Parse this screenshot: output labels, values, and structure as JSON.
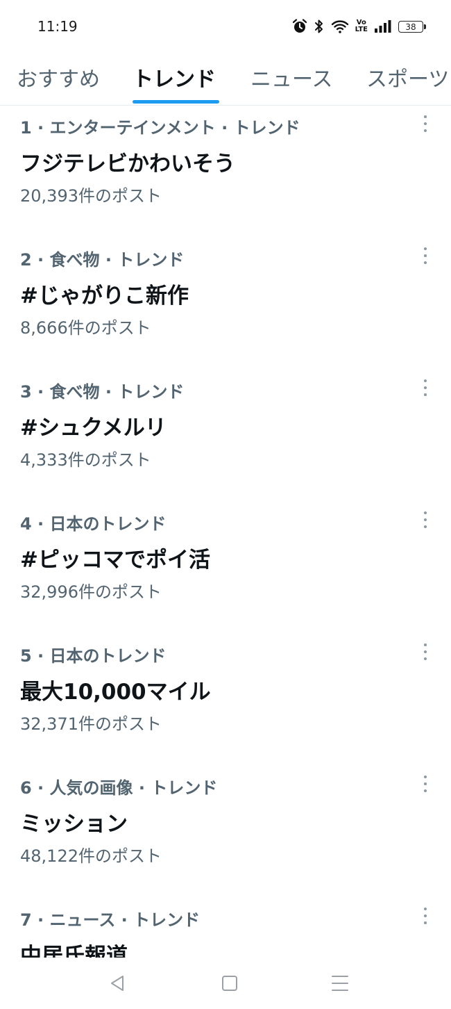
{
  "status_bar": {
    "time": "11:19",
    "icons": [
      "alarm-icon",
      "bluetooth-icon",
      "wifi-icon",
      "volte-icon",
      "signal-icon",
      "battery-icon"
    ],
    "volte_top": "Vo",
    "volte_bottom": "LTE",
    "battery_level": "38"
  },
  "tabs": [
    {
      "label": "おすすめ",
      "active": false
    },
    {
      "label": "トレンド",
      "active": true
    },
    {
      "label": "ニュース",
      "active": false
    },
    {
      "label": "スポーツ",
      "active": false
    }
  ],
  "trends": [
    {
      "context": "1 · エンターテインメント · トレンド",
      "title": "フジテレビかわいそう",
      "count": "20,393件のポスト"
    },
    {
      "context": "2 · 食べ物 · トレンド",
      "title": "#じゃがりこ新作",
      "count": "8,666件のポスト"
    },
    {
      "context": "3 · 食べ物 · トレンド",
      "title": "#シュクメルリ",
      "count": "4,333件のポスト"
    },
    {
      "context": "4 · 日本のトレンド",
      "title": "#ピッコマでポイ活",
      "count": "32,996件のポスト"
    },
    {
      "context": "5 · 日本のトレンド",
      "title": "最大10,000マイル",
      "count": "32,371件のポスト"
    },
    {
      "context": "6 · 人気の画像 · トレンド",
      "title": "ミッション",
      "count": "48,122件のポスト"
    },
    {
      "context": "7 · ニュース · トレンド",
      "title": "中居氏報道",
      "count": ""
    }
  ],
  "nav": {
    "icons": [
      "back-icon",
      "home-icon",
      "menu-icon"
    ]
  },
  "colors": {
    "accent": "#1d9bf0",
    "secondary_text": "#536471",
    "primary_text": "#0f1419"
  }
}
